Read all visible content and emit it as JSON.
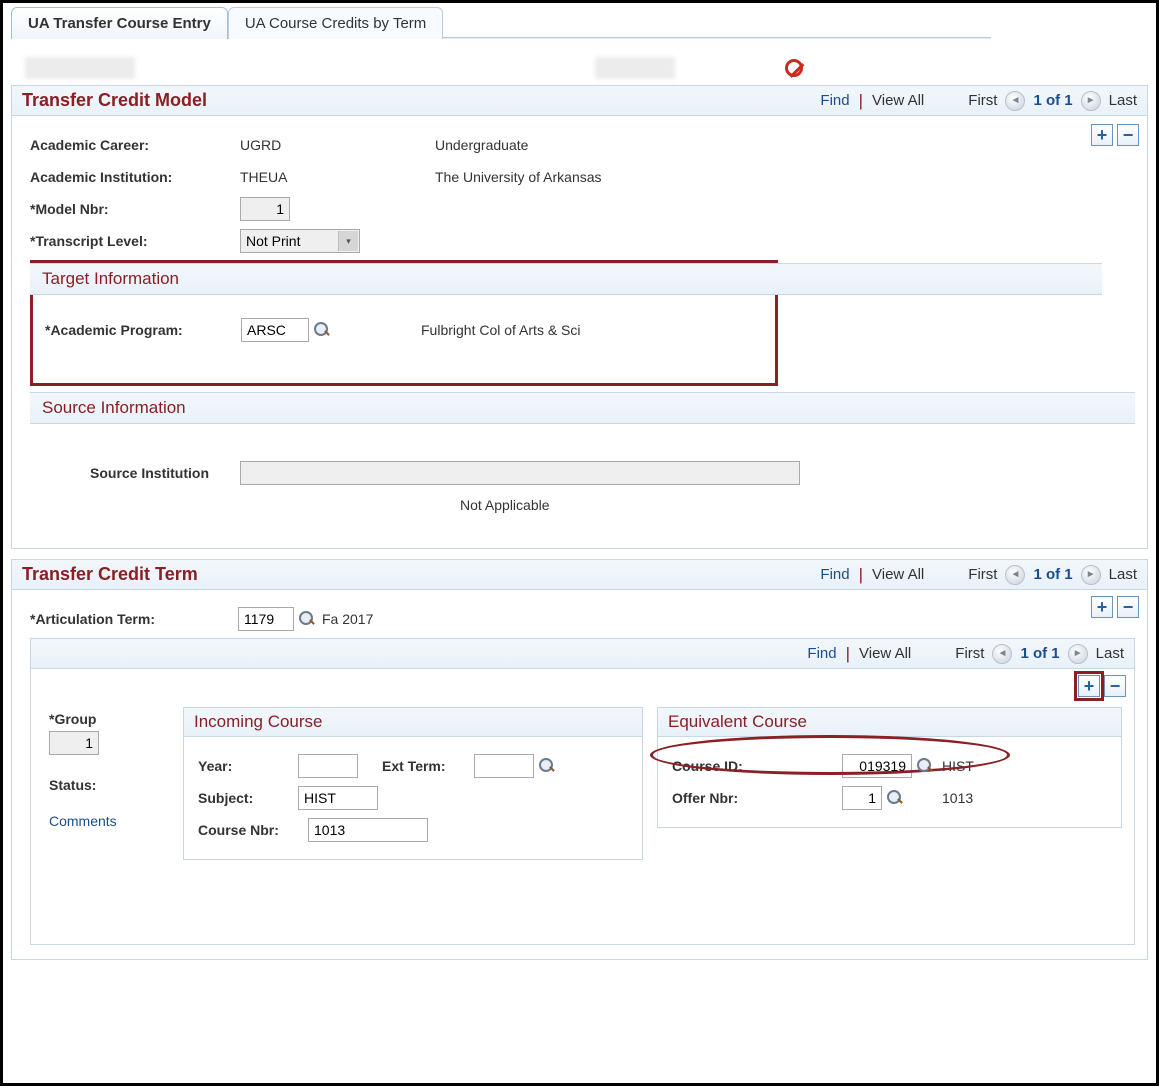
{
  "tabs": {
    "t0": "UA Transfer Course Entry",
    "t1": "UA Course Credits by Term"
  },
  "nav": {
    "find": "Find",
    "view_all": "View All",
    "first": "First",
    "last": "Last",
    "counter": "1 of 1"
  },
  "model": {
    "title": "Transfer Credit Model",
    "career_lbl": "Academic Career:",
    "career_code": "UGRD",
    "career_desc": "Undergraduate",
    "inst_lbl": "Academic Institution:",
    "inst_code": "THEUA",
    "inst_desc": "The University of Arkansas",
    "modelnbr_lbl": "*Model Nbr:",
    "modelnbr_val": "1",
    "tlevel_lbl": "*Transcript Level:",
    "tlevel_val": "Not Print"
  },
  "target": {
    "title": "Target Information",
    "program_lbl": "*Academic Program:",
    "program_val": "ARSC",
    "program_desc": "Fulbright Col of Arts & Sci"
  },
  "source": {
    "title": "Source Information",
    "inst_lbl": "Source Institution",
    "inst_val": "",
    "na": "Not Applicable"
  },
  "term": {
    "title": "Transfer Credit Term",
    "artterm_lbl": "*Articulation Term:",
    "artterm_val": "1179",
    "artterm_desc": "Fa 2017"
  },
  "group": {
    "group_lbl": "*Group",
    "group_val": "1",
    "status_lbl": "Status:",
    "comments": "Comments"
  },
  "incoming": {
    "title": "Incoming Course",
    "year_lbl": "Year:",
    "year_val": "",
    "ext_lbl": "Ext Term:",
    "ext_val": "",
    "subject_lbl": "Subject:",
    "subject_val": "HIST",
    "coursenbr_lbl": "Course Nbr:",
    "coursenbr_val": "1013"
  },
  "equiv": {
    "title": "Equivalent Course",
    "courseid_lbl": "Course ID:",
    "courseid_val": "019319",
    "course_subj": "HIST",
    "offernbr_lbl": "Offer Nbr:",
    "offernbr_val": "1",
    "course_num": "1013"
  }
}
